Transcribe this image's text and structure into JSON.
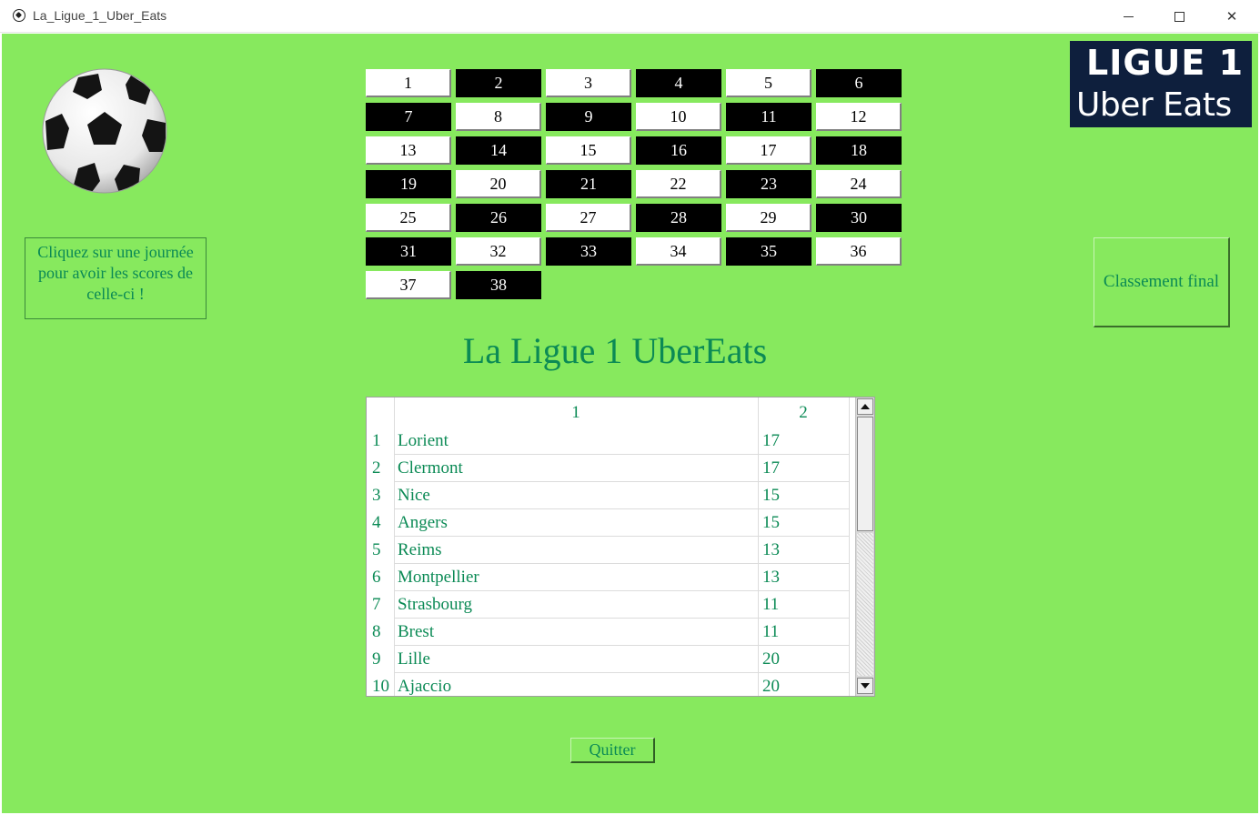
{
  "window": {
    "title": "La_Ligue_1_Uber_Eats",
    "minimize_glyph": "–",
    "maximize_glyph": "☐",
    "close_glyph": "✕"
  },
  "colors": {
    "background": "#87e95e",
    "text_accent": "#0b8a55",
    "logo_bg": "#0e1f3d"
  },
  "logo": {
    "line1": "LIGUE 1",
    "line2": "Uber Eats"
  },
  "hint": "Cliquez sur une journée pour avoir les scores de celle-ci !",
  "days": [
    "1",
    "2",
    "3",
    "4",
    "5",
    "6",
    "7",
    "8",
    "9",
    "10",
    "11",
    "12",
    "13",
    "14",
    "15",
    "16",
    "17",
    "18",
    "19",
    "20",
    "21",
    "22",
    "23",
    "24",
    "25",
    "26",
    "27",
    "28",
    "29",
    "30",
    "31",
    "32",
    "33",
    "34",
    "35",
    "36",
    "37",
    "38"
  ],
  "ranking_button": "Classement final",
  "main_title": "La Ligue 1 UberEats",
  "table": {
    "headers": [
      "1",
      "2"
    ],
    "rows": [
      {
        "index": "1",
        "team": "Lorient",
        "value": "17"
      },
      {
        "index": "2",
        "team": "Clermont",
        "value": "17"
      },
      {
        "index": "3",
        "team": "Nice",
        "value": "15"
      },
      {
        "index": "4",
        "team": "Angers",
        "value": "15"
      },
      {
        "index": "5",
        "team": "Reims",
        "value": "13"
      },
      {
        "index": "6",
        "team": "Montpellier",
        "value": "13"
      },
      {
        "index": "7",
        "team": "Strasbourg",
        "value": "11"
      },
      {
        "index": "8",
        "team": "Brest",
        "value": "11"
      },
      {
        "index": "9",
        "team": "Lille",
        "value": "20"
      },
      {
        "index": "10",
        "team": "Ajaccio",
        "value": "20"
      }
    ]
  },
  "quit_button": "Quitter"
}
